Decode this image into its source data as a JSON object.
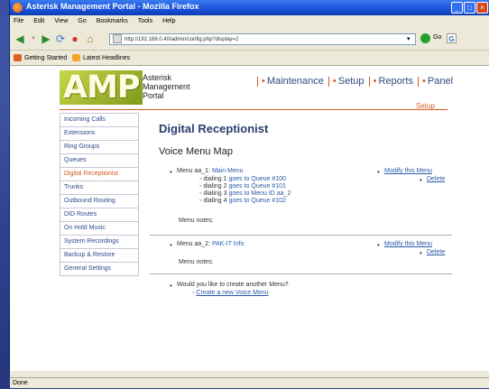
{
  "window": {
    "title": "Asterisk Management Portal - Mozilla Firefox",
    "controls": [
      "_",
      "□",
      "×"
    ]
  },
  "menubar": [
    "File",
    "Edit",
    "View",
    "Go",
    "Bookmarks",
    "Tools",
    "Help"
  ],
  "navbar": {
    "url": "http://192.168.0.40/admin/config.php?display=2",
    "go_label": "Go",
    "search_icon_letter": "G"
  },
  "bookmarks": [
    "Getting Started",
    "Latest Headlines"
  ],
  "logo": {
    "text": "AMP",
    "subtitle_lines": [
      "Asterisk",
      "Management",
      "Portal"
    ]
  },
  "topnav": [
    "Maintenance",
    "Setup",
    "Reports",
    "Panel"
  ],
  "subnav_active": "Setup",
  "sidebar": [
    "Incoming Calls",
    "Extensions",
    "Ring Groups",
    "Queues",
    "Digital Receptionist",
    "Trunks",
    "Outbound Routing",
    "DID Routes",
    "On Hold Music",
    "System Recordings",
    "Backup & Restore",
    "General Settings"
  ],
  "sidebar_active_index": 4,
  "main": {
    "title": "Digital Receptionist",
    "subtitle": "Voice Menu Map",
    "menus": [
      {
        "label": "Menu aa_1:",
        "name": "Main Menu",
        "dialings": [
          {
            "label": "dialing 1",
            "dest": "goes to Queue #100"
          },
          {
            "label": "dialing 2",
            "dest": "goes to Queue #101"
          },
          {
            "label": "dialing 3",
            "dest": "goes to Menu ID aa_2"
          },
          {
            "label": "dialing 4",
            "dest": "goes to Queue #102"
          }
        ],
        "modify": "Modify this Menu",
        "delete": "Delete",
        "notes_label": "Menu notes:"
      },
      {
        "label": "Menu aa_2:",
        "name": "PAK-IT Info",
        "dialings": [],
        "modify": "Modify this Menu",
        "delete": "Delete",
        "notes_label": "Menu notes:"
      }
    ],
    "create_prompt": "Would you like to create another Menu?",
    "create_link": "Create a new Voice Menu"
  },
  "statusbar": "Done"
}
